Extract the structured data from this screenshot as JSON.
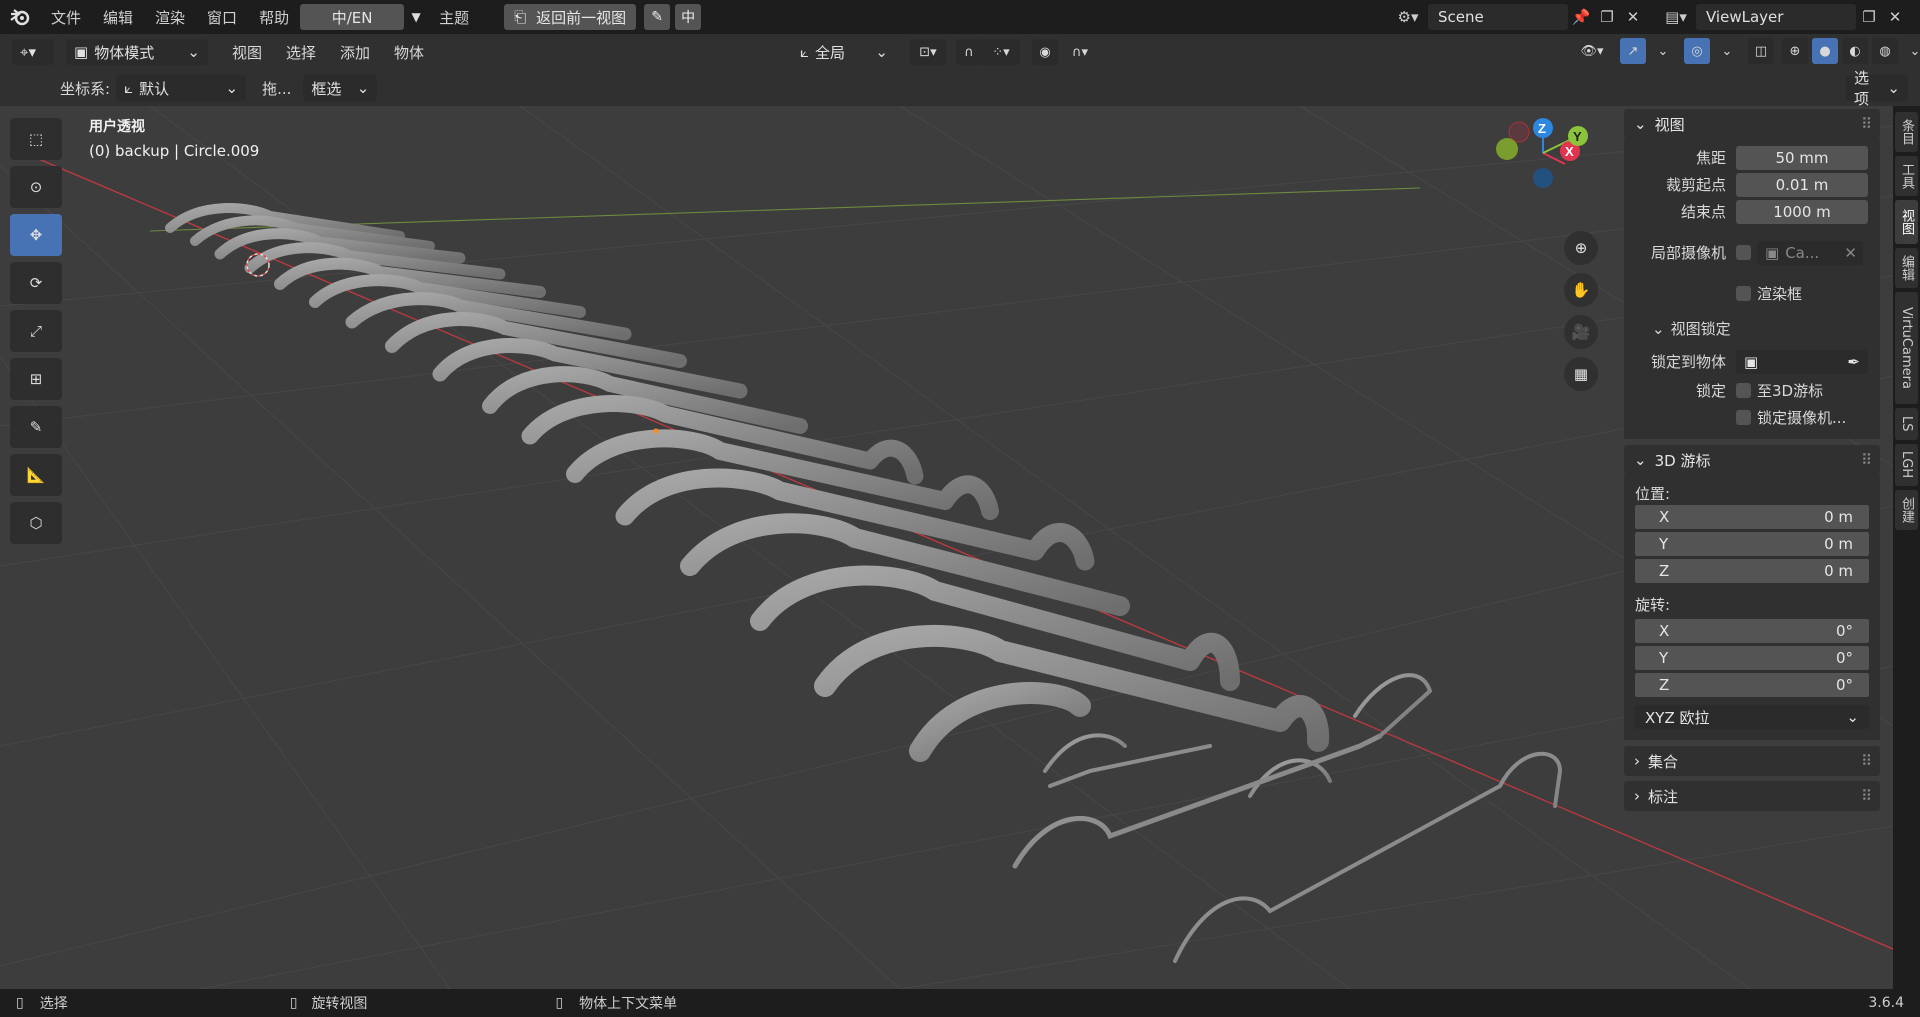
{
  "topbar": {
    "menus": [
      "文件",
      "编辑",
      "渲染",
      "窗口",
      "帮助"
    ],
    "lang_button": "中/EN",
    "theme": "主题",
    "back_button": "返回前一视图",
    "zh_button": "中",
    "scene": "Scene",
    "view_layer": "ViewLayer"
  },
  "header": {
    "mode": "物体模式",
    "menus": [
      "视图",
      "选择",
      "添加",
      "物体"
    ],
    "transform_orientation": "全局",
    "options": "选项"
  },
  "header3": {
    "coord_label": "坐标系:",
    "coord_value": "默认",
    "drag_label": "拖...",
    "select_mode": "框选"
  },
  "viewport": {
    "view_name": "用户透视",
    "object_info": "(0) backup | Circle.009",
    "gizmo": {
      "x": "X",
      "y": "Y",
      "z": "Z"
    }
  },
  "panel": {
    "view": {
      "title": "视图",
      "focal_label": "焦距",
      "focal_value": "50 mm",
      "clip_start_label": "裁剪起点",
      "clip_start_value": "0.01 m",
      "clip_end_label": "结束点",
      "clip_end_value": "1000 m",
      "local_camera_label": "局部摄像机",
      "local_camera_value": "Ca...",
      "render_region": "渲染框"
    },
    "view_lock": {
      "title": "视图锁定",
      "lock_to_object_label": "锁定到物体",
      "lock_label": "锁定",
      "to_3d_cursor": "至3D游标",
      "lock_camera": "锁定摄像机..."
    },
    "cursor": {
      "title": "3D 游标",
      "location_label": "位置:",
      "loc_x": "0 m",
      "loc_y": "0 m",
      "loc_z": "0 m",
      "rotation_label": "旋转:",
      "rot_x": "0°",
      "rot_y": "0°",
      "rot_z": "0°",
      "x": "X",
      "y": "Y",
      "z": "Z",
      "rotation_mode": "XYZ 欧拉"
    },
    "collection": "集合",
    "annotation": "标注"
  },
  "sidetabs": [
    "条目",
    "工具",
    "视图",
    "编辑",
    "VirtuCamera",
    "LS",
    "LGH",
    "创建"
  ],
  "status": {
    "select": "选择",
    "rotate": "旋转视图",
    "context_menu": "物体上下文菜单",
    "version": "3.6.4"
  },
  "colors": {
    "accent": "#4772b3",
    "axis_x": "#e2344f",
    "axis_y": "#8bc33a",
    "axis_z": "#2d86e0"
  }
}
